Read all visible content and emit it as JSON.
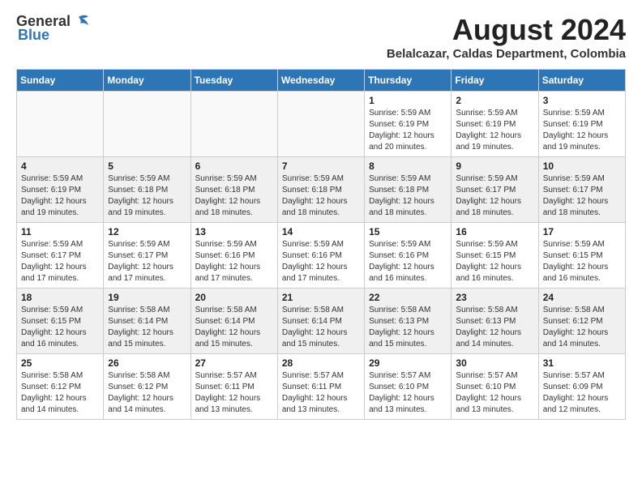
{
  "header": {
    "logo_general": "General",
    "logo_blue": "Blue",
    "month_year": "August 2024",
    "location": "Belalcazar, Caldas Department, Colombia"
  },
  "calendar": {
    "days_of_week": [
      "Sunday",
      "Monday",
      "Tuesday",
      "Wednesday",
      "Thursday",
      "Friday",
      "Saturday"
    ],
    "weeks": [
      [
        {
          "day": "",
          "info": ""
        },
        {
          "day": "",
          "info": ""
        },
        {
          "day": "",
          "info": ""
        },
        {
          "day": "",
          "info": ""
        },
        {
          "day": "1",
          "info": "Sunrise: 5:59 AM\nSunset: 6:19 PM\nDaylight: 12 hours\nand 20 minutes."
        },
        {
          "day": "2",
          "info": "Sunrise: 5:59 AM\nSunset: 6:19 PM\nDaylight: 12 hours\nand 19 minutes."
        },
        {
          "day": "3",
          "info": "Sunrise: 5:59 AM\nSunset: 6:19 PM\nDaylight: 12 hours\nand 19 minutes."
        }
      ],
      [
        {
          "day": "4",
          "info": "Sunrise: 5:59 AM\nSunset: 6:19 PM\nDaylight: 12 hours\nand 19 minutes."
        },
        {
          "day": "5",
          "info": "Sunrise: 5:59 AM\nSunset: 6:18 PM\nDaylight: 12 hours\nand 19 minutes."
        },
        {
          "day": "6",
          "info": "Sunrise: 5:59 AM\nSunset: 6:18 PM\nDaylight: 12 hours\nand 18 minutes."
        },
        {
          "day": "7",
          "info": "Sunrise: 5:59 AM\nSunset: 6:18 PM\nDaylight: 12 hours\nand 18 minutes."
        },
        {
          "day": "8",
          "info": "Sunrise: 5:59 AM\nSunset: 6:18 PM\nDaylight: 12 hours\nand 18 minutes."
        },
        {
          "day": "9",
          "info": "Sunrise: 5:59 AM\nSunset: 6:17 PM\nDaylight: 12 hours\nand 18 minutes."
        },
        {
          "day": "10",
          "info": "Sunrise: 5:59 AM\nSunset: 6:17 PM\nDaylight: 12 hours\nand 18 minutes."
        }
      ],
      [
        {
          "day": "11",
          "info": "Sunrise: 5:59 AM\nSunset: 6:17 PM\nDaylight: 12 hours\nand 17 minutes."
        },
        {
          "day": "12",
          "info": "Sunrise: 5:59 AM\nSunset: 6:17 PM\nDaylight: 12 hours\nand 17 minutes."
        },
        {
          "day": "13",
          "info": "Sunrise: 5:59 AM\nSunset: 6:16 PM\nDaylight: 12 hours\nand 17 minutes."
        },
        {
          "day": "14",
          "info": "Sunrise: 5:59 AM\nSunset: 6:16 PM\nDaylight: 12 hours\nand 17 minutes."
        },
        {
          "day": "15",
          "info": "Sunrise: 5:59 AM\nSunset: 6:16 PM\nDaylight: 12 hours\nand 16 minutes."
        },
        {
          "day": "16",
          "info": "Sunrise: 5:59 AM\nSunset: 6:15 PM\nDaylight: 12 hours\nand 16 minutes."
        },
        {
          "day": "17",
          "info": "Sunrise: 5:59 AM\nSunset: 6:15 PM\nDaylight: 12 hours\nand 16 minutes."
        }
      ],
      [
        {
          "day": "18",
          "info": "Sunrise: 5:59 AM\nSunset: 6:15 PM\nDaylight: 12 hours\nand 16 minutes."
        },
        {
          "day": "19",
          "info": "Sunrise: 5:58 AM\nSunset: 6:14 PM\nDaylight: 12 hours\nand 15 minutes."
        },
        {
          "day": "20",
          "info": "Sunrise: 5:58 AM\nSunset: 6:14 PM\nDaylight: 12 hours\nand 15 minutes."
        },
        {
          "day": "21",
          "info": "Sunrise: 5:58 AM\nSunset: 6:14 PM\nDaylight: 12 hours\nand 15 minutes."
        },
        {
          "day": "22",
          "info": "Sunrise: 5:58 AM\nSunset: 6:13 PM\nDaylight: 12 hours\nand 15 minutes."
        },
        {
          "day": "23",
          "info": "Sunrise: 5:58 AM\nSunset: 6:13 PM\nDaylight: 12 hours\nand 14 minutes."
        },
        {
          "day": "24",
          "info": "Sunrise: 5:58 AM\nSunset: 6:12 PM\nDaylight: 12 hours\nand 14 minutes."
        }
      ],
      [
        {
          "day": "25",
          "info": "Sunrise: 5:58 AM\nSunset: 6:12 PM\nDaylight: 12 hours\nand 14 minutes."
        },
        {
          "day": "26",
          "info": "Sunrise: 5:58 AM\nSunset: 6:12 PM\nDaylight: 12 hours\nand 14 minutes."
        },
        {
          "day": "27",
          "info": "Sunrise: 5:57 AM\nSunset: 6:11 PM\nDaylight: 12 hours\nand 13 minutes."
        },
        {
          "day": "28",
          "info": "Sunrise: 5:57 AM\nSunset: 6:11 PM\nDaylight: 12 hours\nand 13 minutes."
        },
        {
          "day": "29",
          "info": "Sunrise: 5:57 AM\nSunset: 6:10 PM\nDaylight: 12 hours\nand 13 minutes."
        },
        {
          "day": "30",
          "info": "Sunrise: 5:57 AM\nSunset: 6:10 PM\nDaylight: 12 hours\nand 13 minutes."
        },
        {
          "day": "31",
          "info": "Sunrise: 5:57 AM\nSunset: 6:09 PM\nDaylight: 12 hours\nand 12 minutes."
        }
      ]
    ]
  }
}
